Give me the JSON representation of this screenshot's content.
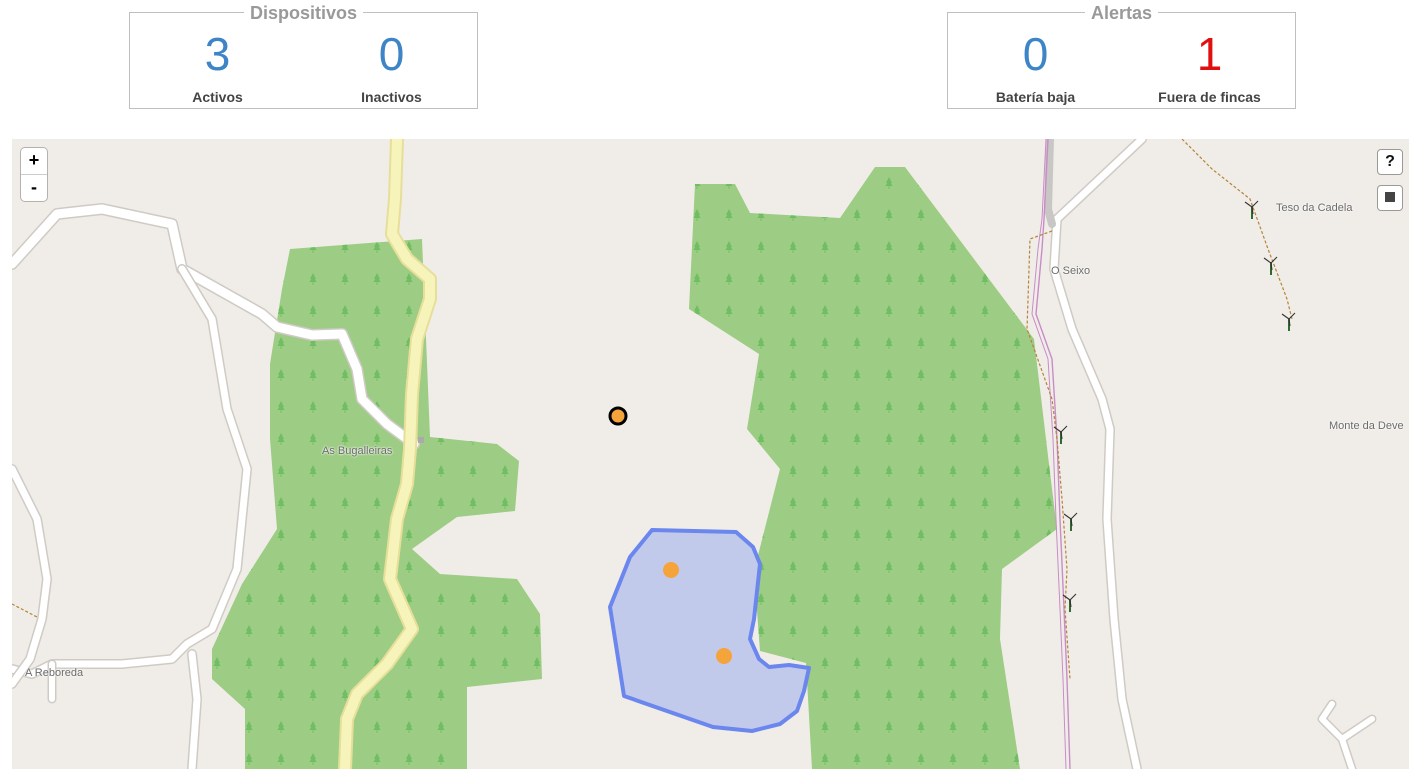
{
  "dispositivos": {
    "title": "Dispositivos",
    "activos": {
      "value": "3",
      "label": "Activos"
    },
    "inactivos": {
      "value": "0",
      "label": "Inactivos"
    }
  },
  "alertas": {
    "title": "Alertas",
    "bateria_baja": {
      "value": "0",
      "label": "Batería baja"
    },
    "fuera_de_fincas": {
      "value": "1",
      "label": "Fuera de fincas"
    }
  },
  "map": {
    "zoom_in_label": "+",
    "zoom_out_label": "-",
    "help_label": "?",
    "stop_icon": "stop-square-icon",
    "place_labels": {
      "as_bugalleiras": "As Bugalleiras",
      "o_seixo": "O Seixo",
      "teso_da_cadela": "Teso da Cadela",
      "monte_da_deve": "Monte da Deve",
      "a_reboreda": "A Reboreda"
    },
    "colors": {
      "background": "#f0ede8",
      "forest": "#9dcc84",
      "farm_fill": "#c2caeb",
      "farm_stroke": "#6b87ee",
      "device": "#f5a43c",
      "number_blue": "#3d85c6",
      "number_red": "#e01010"
    }
  }
}
